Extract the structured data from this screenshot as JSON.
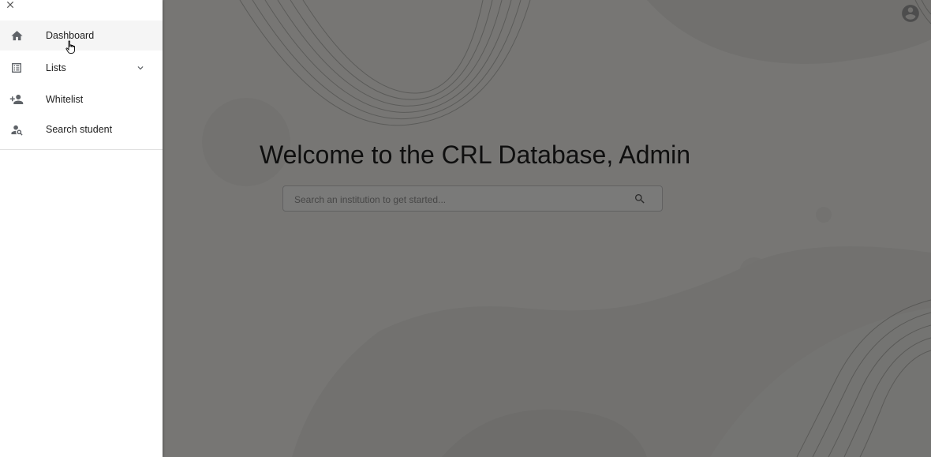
{
  "main": {
    "welcome_title": "Welcome to the CRL Database, Admin",
    "search": {
      "placeholder": "Search an institution to get started..."
    },
    "icons": {
      "search": "search-icon",
      "avatar": "account-circle-icon"
    }
  },
  "drawer": {
    "close_icon": "close-icon",
    "items": [
      {
        "label": "Dashboard",
        "icon": "home-icon",
        "active": true
      },
      {
        "label": "Lists",
        "icon": "list-icon",
        "expandable": true
      },
      {
        "label": "Whitelist",
        "icon": "person-add-icon"
      },
      {
        "label": "Search student",
        "icon": "person-search-icon"
      }
    ]
  },
  "colors": {
    "overlay": "rgba(0,0,0,0.5)",
    "drawer_bg": "#ffffff",
    "active_item_bg": "#f5f5f5",
    "text": "#212121"
  }
}
